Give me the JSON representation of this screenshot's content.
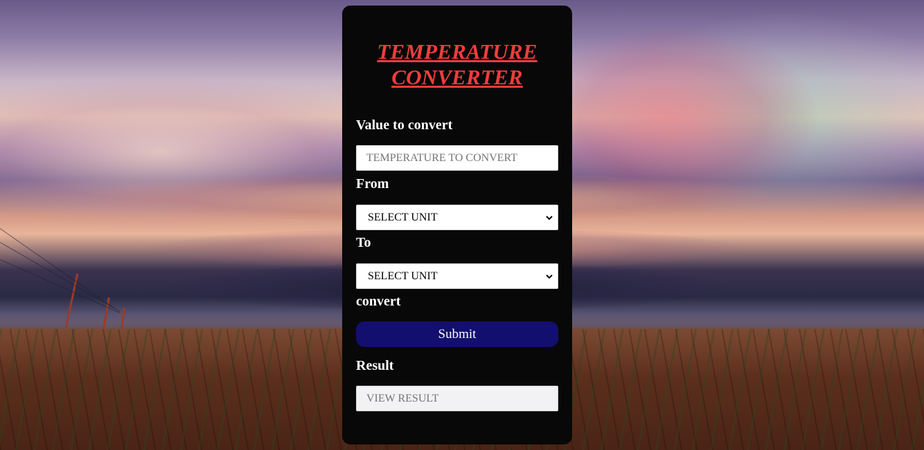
{
  "form": {
    "title_line1": "TEMPERATURE",
    "title_line2": "CONVERTER",
    "value_label": "Value to convert",
    "value_placeholder": "TEMPERATURE TO CONVERT",
    "from_label": "From",
    "from_selected": "SELECT UNIT",
    "to_label": "To",
    "to_selected": "SELECT UNIT",
    "convert_label": "convert",
    "submit_label": "Submit",
    "result_label": "Result",
    "result_placeholder": "VIEW RESULT"
  },
  "colors": {
    "card_bg": "#080808",
    "title": "#f23c3c",
    "submit_bg": "#130f6e",
    "result_bg": "#f2f1f3"
  },
  "icons": {
    "select_arrow": "chevron-down-icon"
  }
}
